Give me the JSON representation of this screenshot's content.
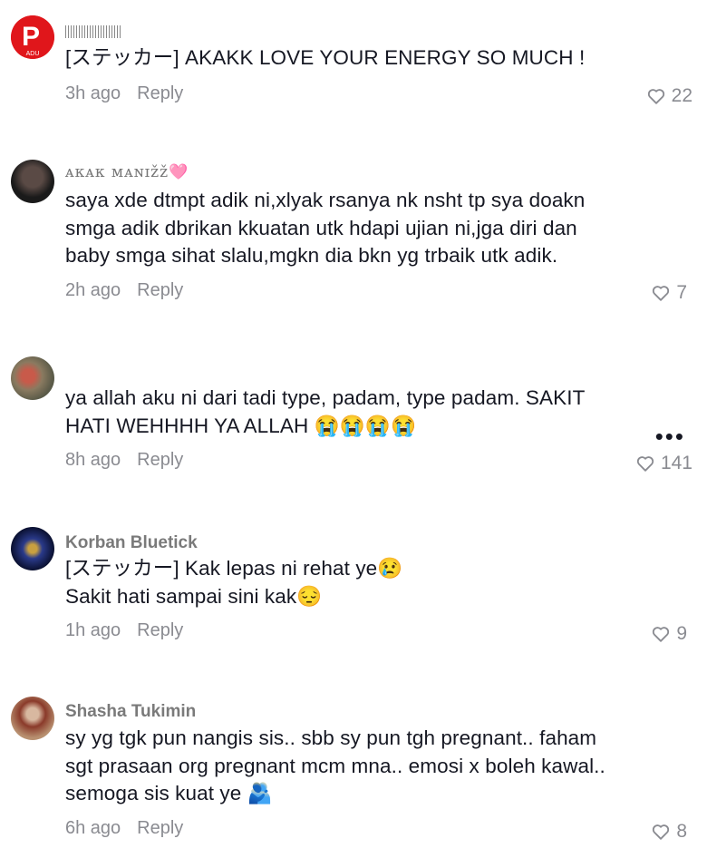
{
  "comments": [
    {
      "username": "",
      "lines": [
        "[ステッカー] AKAKK LOVE YOUR ENERGY SO MUCH !"
      ],
      "time": "3h ago",
      "reply": "Reply",
      "likes": "22",
      "avatar_letter": "P",
      "avatar_sub": "ADU",
      "avatar_color": "#e0161b"
    },
    {
      "username": "ᴀᴋᴀᴋ ᴍᴀɴɪžž🩷",
      "lines": [
        "saya xde dtmpt adik ni,xlyak rsanya nk nsht tp sya doakn",
        "smga adik dbrikan kkuatan utk hdapi ujian ni,jga diri dan",
        "baby smga sihat slalu,mgkn dia bkn yg trbaik utk adik."
      ],
      "time": "2h ago",
      "reply": "Reply",
      "likes": "7"
    },
    {
      "username": "",
      "lines": [
        "ya allah aku ni dari tadi type, padam, type padam. SAKIT",
        "HATI WEHHHH YA ALLAH 😭😭😭😭"
      ],
      "time": "8h ago",
      "reply": "Reply",
      "likes": "141"
    },
    {
      "username": "Korban Bluetick",
      "lines": [
        "[ステッカー] Kak lepas ni rehat ye😢",
        "Sakit hati sampai sini kak😔"
      ],
      "time": "1h ago",
      "reply": "Reply",
      "likes": "9"
    },
    {
      "username": "Shasha Tukimin",
      "lines": [
        "sy yg tgk pun nangis sis.. sbb sy pun tgh pregnant.. faham",
        "sgt prasaan org pregnant mcm mna.. emosi x boleh kawal..",
        "semoga sis kuat ye 🫂"
      ],
      "time": "6h ago",
      "reply": "Reply",
      "likes": "8"
    }
  ],
  "more_label": "•••",
  "colors": {
    "secondary_text": "#8a8b91",
    "primary_text": "#161823"
  }
}
